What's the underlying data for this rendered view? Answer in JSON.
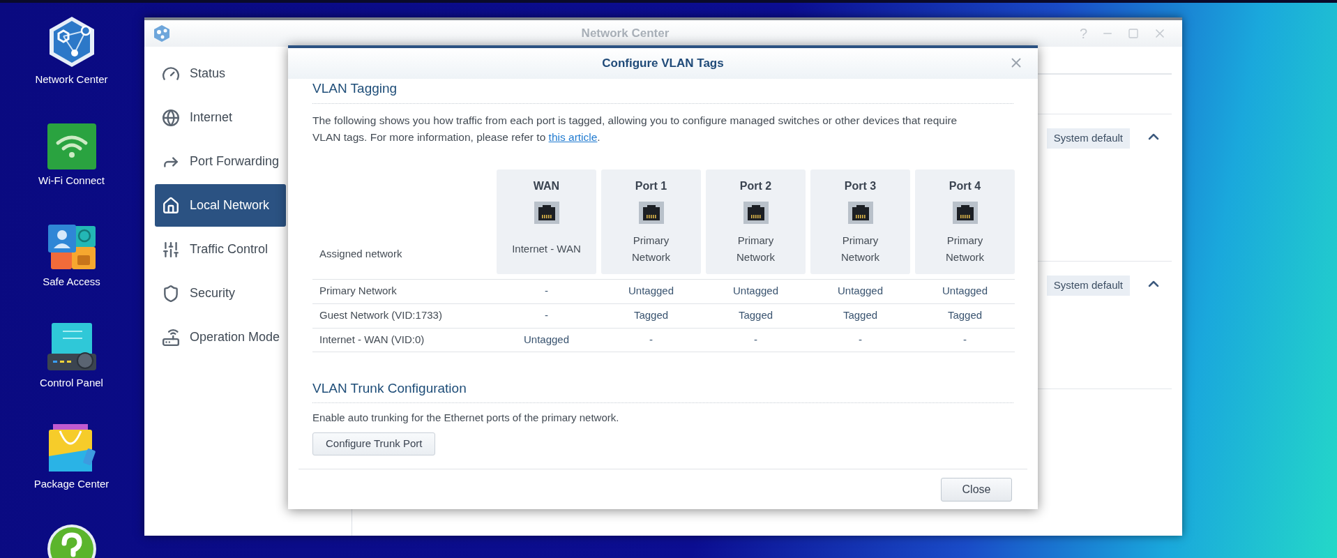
{
  "desktop": {
    "icons": [
      {
        "kind": "network",
        "label": "Network Center"
      },
      {
        "kind": "wifi",
        "label": "Wi-Fi Connect"
      },
      {
        "kind": "safe",
        "label": "Safe Access"
      },
      {
        "kind": "control",
        "label": "Control Panel"
      },
      {
        "kind": "package",
        "label": "Package Center"
      },
      {
        "kind": "help"
      }
    ]
  },
  "window": {
    "title": "Network Center",
    "help_glyph": "?",
    "sidebar": {
      "items": [
        {
          "kind": "status",
          "label": "Status",
          "selected": false
        },
        {
          "kind": "internet",
          "label": "Internet",
          "selected": false
        },
        {
          "kind": "forwarding",
          "label": "Port Forwarding",
          "selected": false
        },
        {
          "kind": "local",
          "label": "Local Network",
          "selected": true
        },
        {
          "kind": "traffic",
          "label": "Traffic Control",
          "selected": false
        },
        {
          "kind": "security",
          "label": "Security",
          "selected": false
        },
        {
          "kind": "modes",
          "label": "Operation Mode",
          "selected": false
        }
      ]
    },
    "panels": [
      {
        "badge": "System default",
        "expanded": true
      },
      {
        "badge": "System default",
        "expanded": true
      }
    ]
  },
  "dialog": {
    "title": "Configure VLAN Tags",
    "tagging": {
      "heading": "VLAN Tagging",
      "description": "The following shows you how traffic from each port is tagged, allowing you to configure managed switches or other devices that require VLAN tags. For more information, please refer to ",
      "link": "this article",
      "description_end": ".",
      "assigned_label": "Assigned network",
      "ports": [
        {
          "name": "WAN",
          "assigned": "Internet - WAN"
        },
        {
          "name": "Port 1",
          "assigned": "Primary Network"
        },
        {
          "name": "Port 2",
          "assigned": "Primary Network"
        },
        {
          "name": "Port 3",
          "assigned": "Primary Network"
        },
        {
          "name": "Port 4",
          "assigned": "Primary Network"
        }
      ],
      "rows": [
        {
          "network": "Primary Network",
          "cells": [
            "-",
            "Untagged",
            "Untagged",
            "Untagged",
            "Untagged"
          ]
        },
        {
          "network": "Guest Network (VID:1733)",
          "cells": [
            "-",
            "Tagged",
            "Tagged",
            "Tagged",
            "Tagged"
          ]
        },
        {
          "network": "Internet - WAN (VID:0)",
          "cells": [
            "Untagged",
            "-",
            "-",
            "-",
            "-"
          ]
        }
      ]
    },
    "trunk": {
      "heading": "VLAN Trunk Configuration",
      "description": "Enable auto trunking for the Ethernet ports of the primary network.",
      "button": "Configure Trunk Port"
    },
    "close_button": "Close"
  }
}
